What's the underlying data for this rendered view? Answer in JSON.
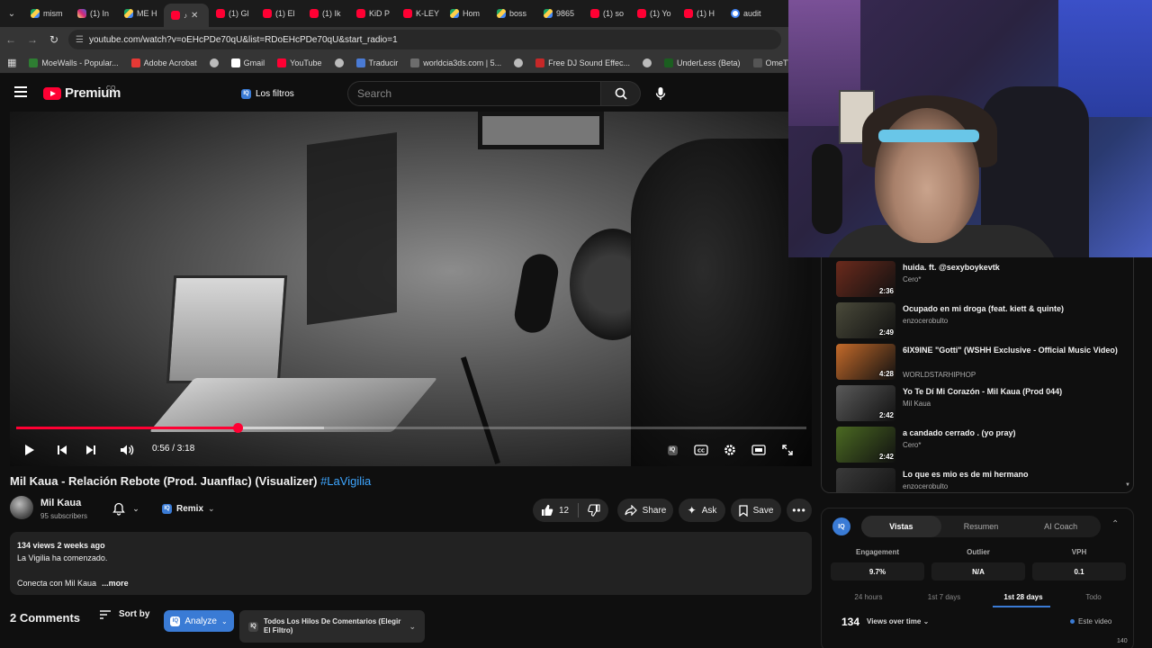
{
  "browser": {
    "tabs": [
      {
        "label": "mism",
        "fav": "drive"
      },
      {
        "label": "(1) In",
        "fav": "ig"
      },
      {
        "label": "ME H",
        "fav": "drive"
      },
      {
        "label": "",
        "fav": "red",
        "active": true
      },
      {
        "label": "(1) Gl",
        "fav": "red"
      },
      {
        "label": "(1) El",
        "fav": "red"
      },
      {
        "label": "(1) Ik",
        "fav": "red"
      },
      {
        "label": "KiD P",
        "fav": "red"
      },
      {
        "label": "K-LEY",
        "fav": "red"
      },
      {
        "label": "Hom",
        "fav": "drive"
      },
      {
        "label": "boss",
        "fav": "drive"
      },
      {
        "label": "9865",
        "fav": "drive"
      },
      {
        "label": "(1) so",
        "fav": "red"
      },
      {
        "label": "(1) Yo",
        "fav": "red"
      },
      {
        "label": "(1) H",
        "fav": "red"
      },
      {
        "label": "audit",
        "fav": "g"
      }
    ],
    "url": "youtube.com/watch?v=oEHcPDe70qU&list=RDoEHcPDe70qU&start_radio=1",
    "bookmarks": [
      "MoeWalls - Popular...",
      "Adobe Acrobat",
      "Gmail",
      "YouTube",
      "Traducir",
      "worldcia3ds.com | 5...",
      "Free DJ Sound Effec...",
      "UnderLess (Beta)",
      "OmeTV Video Chat..."
    ]
  },
  "header": {
    "logo_text": "Premium",
    "logo_country": "CO",
    "filter_chip": "Los filtros",
    "search_placeholder": "Search"
  },
  "player": {
    "time": "0:56 / 3:18",
    "progress": 0.28,
    "buffered": 0.39
  },
  "video": {
    "title": "Mil Kaua - Relación Rebote (Prod. Juanflac) (Visualizer)",
    "hashtag": "#LaVigilia",
    "channel": "Mil Kaua",
    "subscribers": "95 subscribers",
    "remix": "Remix",
    "likes": "12",
    "share": "Share",
    "ask": "Ask",
    "save": "Save"
  },
  "description": {
    "meta": "134 views  2 weeks ago",
    "line1": "La Vigilia ha comenzado.",
    "line2": "Conecta con Mil Kaua",
    "more": "...more"
  },
  "comments": {
    "count": "2 Comments",
    "sort": "Sort by",
    "analyze": "Analyze",
    "thread_filter": "Todos Los Hilos De Comentarios (Elegir El Filtro)"
  },
  "playlist": [
    {
      "title": "huida. ft. @sexyboykevtk",
      "channel": "Cero*",
      "duration": "2:36",
      "thumb": "#6b2a1c"
    },
    {
      "title": "Ocupado en mi droga (feat. kiett & quinte)",
      "channel": "enzocerobulto",
      "duration": "2:49",
      "thumb": "#4a4a3a"
    },
    {
      "title": "6IX9INE \"Gotti\" (WSHH Exclusive - Official Music Video)",
      "channel": "WORLDSTARHIPHOP",
      "duration": "4:28",
      "thumb": "#c46a2a"
    },
    {
      "title": "Yo Te Dí Mi Corazón - Mil Kaua (Prod 044)",
      "channel": "Mil Kaua",
      "duration": "2:42",
      "thumb": "#5a5a5a"
    },
    {
      "title": "a candado cerrado . (yo pray)",
      "channel": "Cero*",
      "duration": "2:42",
      "thumb": "#4b6a22"
    },
    {
      "title": "Lo que es mio es de mi hermano",
      "channel": "enzocerobulto",
      "duration": "",
      "thumb": "#3a3a3a"
    }
  ],
  "iq": {
    "logo": "IQ",
    "tabs": [
      "Vistas",
      "Resumen",
      "AI Coach"
    ],
    "metrics": [
      {
        "label": "Engagement",
        "value": "9.7%"
      },
      {
        "label": "Outlier",
        "value": "N/A"
      },
      {
        "label": "VPH",
        "value": "0.1"
      }
    ],
    "ranges": [
      "24 hours",
      "1st 7 days",
      "1st 28 days",
      "Todo"
    ],
    "views": "134",
    "views_over": "Views over time",
    "legend": "Este video",
    "chart_tick": "140"
  },
  "colors": {
    "accent_red": "#ff0033",
    "link_blue": "#3ea6ff",
    "iq_blue": "#3a7bd5"
  }
}
